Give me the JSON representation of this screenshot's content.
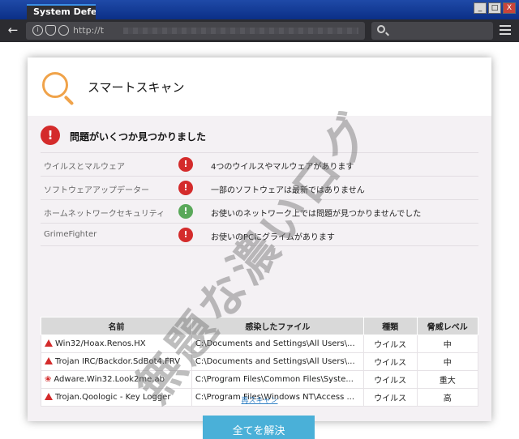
{
  "browser": {
    "tab_title": "System Defe",
    "url": "http://t",
    "window_buttons": [
      "_",
      "□",
      "X"
    ]
  },
  "card": {
    "title": "スマートスキャン",
    "problem_title": "問題がいくつか見つかりました",
    "categories": [
      {
        "name": "ウイルスとマルウェア",
        "status": "error",
        "icon": "!",
        "description": "4つのウイルスやマルウェアがあります"
      },
      {
        "name": "ソフトウェアアップデーター",
        "status": "error",
        "icon": "!",
        "description": "一部のソフトウェアは最新ではありません"
      },
      {
        "name": "ホームネットワークセキュリティ",
        "status": "ok",
        "icon": "!",
        "description": "お使いのネットワーク上では問題が見つかりませんでした"
      },
      {
        "name": "GrimeFighter",
        "status": "error",
        "icon": "!",
        "description": "お使いのPCにグライムがあります"
      }
    ],
    "table": {
      "headers": [
        "名前",
        "感染したファイル",
        "種類",
        "脅威レベル"
      ],
      "rows": [
        {
          "icon": "warning-icon",
          "name": "Win32/Hoax.Renos.HX",
          "file": "C:\\Documents and Settings\\All Users\\...",
          "type": "ウイルス",
          "level": "中"
        },
        {
          "icon": "warning-icon",
          "name": "Trojan IRC/Backdor.SdBot4.FRV",
          "file": "C:\\Documents and Settings\\All Users\\...",
          "type": "ウイルス",
          "level": "中"
        },
        {
          "icon": "bug-icon",
          "name": "Adware.Win32.Look2me.ab",
          "file": "C:\\Program Files\\Common Files\\Syste...",
          "type": "ウイルス",
          "level": "重大"
        },
        {
          "icon": "warning-icon",
          "name": "Trojan.Qoologic - Key Logger",
          "file": "C:\\Program Files\\Windows NT\\Access ...",
          "type": "ウイルス",
          "level": "高"
        }
      ]
    },
    "fix_button": "全てを解決",
    "rescan_link": "再スキャン"
  },
  "watermark": "無題な濃いログ",
  "colors": {
    "danger": "#d42b2b",
    "ok": "#5aa85a",
    "accent": "#4ab0d8",
    "titlebar": "#0b2f86"
  }
}
